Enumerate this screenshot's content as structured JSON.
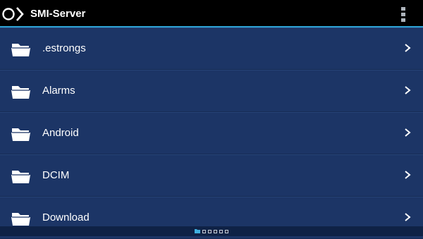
{
  "app_bar": {
    "title": "SMI-Server",
    "logo_icon": "smi-logo-icon",
    "menu_icon": "overflow-menu-icon",
    "accent_color": "#2ea3d6"
  },
  "folders": [
    {
      "label": ".estrongs",
      "icon": "folder-icon"
    },
    {
      "label": "Alarms",
      "icon": "folder-icon"
    },
    {
      "label": "Android",
      "icon": "folder-icon"
    },
    {
      "label": "DCIM",
      "icon": "folder-icon"
    },
    {
      "label": "Download",
      "icon": "folder-icon"
    }
  ],
  "page_indicator": {
    "page_count": 6,
    "current_page": 1,
    "active_color": "#3fb0e0"
  },
  "colors": {
    "background": "#1c3566",
    "action_bar": "#000000"
  }
}
